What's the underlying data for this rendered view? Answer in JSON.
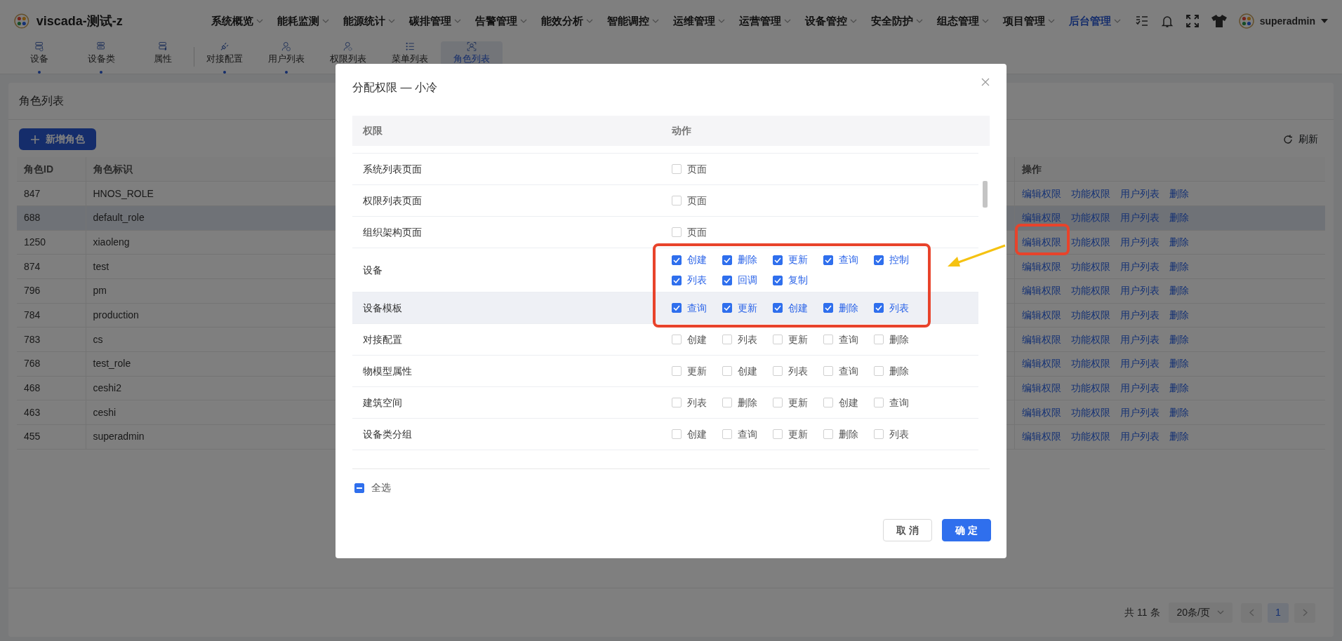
{
  "app": {
    "name": "viscada-测试-z"
  },
  "top_menu": [
    {
      "label": "系统概览",
      "selected": false
    },
    {
      "label": "能耗监测",
      "selected": false
    },
    {
      "label": "能源统计",
      "selected": false
    },
    {
      "label": "碳排管理",
      "selected": false
    },
    {
      "label": "告警管理",
      "selected": false
    },
    {
      "label": "能效分析",
      "selected": false
    },
    {
      "label": "智能调控",
      "selected": false
    },
    {
      "label": "运维管理",
      "selected": false
    },
    {
      "label": "运营管理",
      "selected": false
    },
    {
      "label": "设备管控",
      "selected": false
    },
    {
      "label": "安全防护",
      "selected": false
    },
    {
      "label": "组态管理",
      "selected": false
    },
    {
      "label": "项目管理",
      "selected": false
    },
    {
      "label": "后台管理",
      "selected": true
    }
  ],
  "user": {
    "name": "superadmin"
  },
  "sub_tabs": [
    {
      "label": "设备",
      "selected": false,
      "dot": true,
      "divider_before": false
    },
    {
      "label": "设备类",
      "selected": false,
      "dot": true,
      "divider_before": false
    },
    {
      "label": "属性",
      "selected": false,
      "dot": false,
      "divider_before": false
    },
    {
      "label": "对接配置",
      "selected": false,
      "dot": true,
      "divider_before": true
    },
    {
      "label": "用户列表",
      "selected": false,
      "dot": true,
      "divider_before": false
    },
    {
      "label": "权限列表",
      "selected": false,
      "divider_before": false
    },
    {
      "label": "菜单列表",
      "selected": false,
      "divider_before": false
    },
    {
      "label": "角色列表",
      "selected": true,
      "divider_before": false
    }
  ],
  "page": {
    "title": "角色列表",
    "add_button": "新增角色",
    "refresh": "刷新"
  },
  "table": {
    "columns": [
      "角色ID",
      "角色标识",
      "操作"
    ],
    "rows": [
      {
        "id": "847",
        "role": "HNOS_ROLE",
        "hovered": false,
        "actions": [
          "编辑权限",
          "功能权限",
          "用户列表",
          "删除"
        ]
      },
      {
        "id": "688",
        "role": "default_role",
        "hovered": true,
        "actions": [
          "编辑权限",
          "功能权限",
          "用户列表",
          "删除"
        ]
      },
      {
        "id": "1250",
        "role": "xiaoleng",
        "hovered": false,
        "actions": [
          "编辑权限",
          "功能权限",
          "用户列表",
          "删除"
        ]
      },
      {
        "id": "874",
        "role": "test",
        "hovered": false,
        "actions": [
          "编辑权限",
          "功能权限",
          "用户列表",
          "删除"
        ]
      },
      {
        "id": "796",
        "role": "pm",
        "hovered": false,
        "actions": [
          "编辑权限",
          "功能权限",
          "用户列表",
          "删除"
        ]
      },
      {
        "id": "784",
        "role": "production",
        "hovered": false,
        "actions": [
          "编辑权限",
          "功能权限",
          "用户列表",
          "删除"
        ]
      },
      {
        "id": "783",
        "role": "cs",
        "hovered": false,
        "actions": [
          "编辑权限",
          "功能权限",
          "用户列表",
          "删除"
        ]
      },
      {
        "id": "768",
        "role": "test_role",
        "hovered": false,
        "actions": [
          "编辑权限",
          "功能权限",
          "用户列表",
          "删除"
        ]
      },
      {
        "id": "468",
        "role": "ceshi2",
        "hovered": false,
        "actions": [
          "编辑权限",
          "功能权限",
          "用户列表",
          "删除"
        ]
      },
      {
        "id": "463",
        "role": "ceshi",
        "hovered": false,
        "actions": [
          "编辑权限",
          "功能权限",
          "用户列表",
          "删除"
        ]
      },
      {
        "id": "455",
        "role": "superadmin",
        "hovered": false,
        "actions": [
          "编辑权限",
          "功能权限",
          "用户列表",
          "删除"
        ]
      }
    ]
  },
  "pagination": {
    "total": "共 11 条",
    "page_size": "20条/页",
    "pages": [
      {
        "label": "1",
        "selected": true
      }
    ]
  },
  "dialog": {
    "title": "分配权限 — 小冷",
    "columns": [
      "权限",
      "动作"
    ],
    "rows": [
      {
        "name": "系统列表页面",
        "highlighted": false,
        "actions": [
          {
            "label": "页面",
            "checked": false
          }
        ]
      },
      {
        "name": "权限列表页面",
        "highlighted": false,
        "actions": [
          {
            "label": "页面",
            "checked": false
          }
        ]
      },
      {
        "name": "组织架构页面",
        "highlighted": false,
        "actions": [
          {
            "label": "页面",
            "checked": false
          }
        ]
      },
      {
        "name": "设备",
        "highlighted": false,
        "actions": [
          {
            "label": "创建",
            "checked": true
          },
          {
            "label": "删除",
            "checked": true
          },
          {
            "label": "更新",
            "checked": true
          },
          {
            "label": "查询",
            "checked": true
          },
          {
            "label": "控制",
            "checked": true
          },
          {
            "label": "列表",
            "checked": true
          },
          {
            "label": "回调",
            "checked": true
          },
          {
            "label": "复制",
            "checked": true
          }
        ]
      },
      {
        "name": "设备模板",
        "highlighted": true,
        "actions": [
          {
            "label": "查询",
            "checked": true
          },
          {
            "label": "更新",
            "checked": true
          },
          {
            "label": "创建",
            "checked": true
          },
          {
            "label": "删除",
            "checked": true
          },
          {
            "label": "列表",
            "checked": true
          }
        ]
      },
      {
        "name": "对接配置",
        "highlighted": false,
        "actions": [
          {
            "label": "创建",
            "checked": false
          },
          {
            "label": "列表",
            "checked": false
          },
          {
            "label": "更新",
            "checked": false
          },
          {
            "label": "查询",
            "checked": false
          },
          {
            "label": "删除",
            "checked": false
          }
        ]
      },
      {
        "name": "物模型属性",
        "highlighted": false,
        "actions": [
          {
            "label": "更新",
            "checked": false
          },
          {
            "label": "创建",
            "checked": false
          },
          {
            "label": "列表",
            "checked": false
          },
          {
            "label": "查询",
            "checked": false
          },
          {
            "label": "删除",
            "checked": false
          }
        ]
      },
      {
        "name": "建筑空间",
        "highlighted": false,
        "actions": [
          {
            "label": "列表",
            "checked": false
          },
          {
            "label": "删除",
            "checked": false
          },
          {
            "label": "更新",
            "checked": false
          },
          {
            "label": "创建",
            "checked": false
          },
          {
            "label": "查询",
            "checked": false
          }
        ]
      },
      {
        "name": "设备类分组",
        "highlighted": false,
        "actions": [
          {
            "label": "创建",
            "checked": false
          },
          {
            "label": "查询",
            "checked": false
          },
          {
            "label": "更新",
            "checked": false
          },
          {
            "label": "删除",
            "checked": false
          },
          {
            "label": "列表",
            "checked": false
          }
        ]
      }
    ],
    "select_all": {
      "label": "全选",
      "indeterminate": true
    },
    "buttons": [
      {
        "label": "取 消",
        "kind": "secondary"
      },
      {
        "label": "确 定",
        "kind": "primary"
      }
    ]
  }
}
